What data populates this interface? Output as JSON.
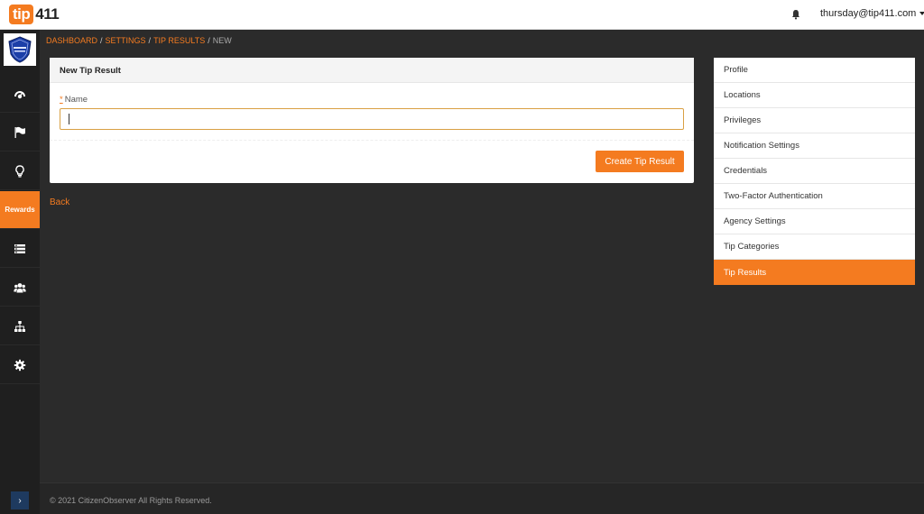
{
  "header": {
    "logo_part1": "tip",
    "logo_part2": "411",
    "user_email": "thursday@tip411.com",
    "notification_icon": "bell-icon"
  },
  "sidebar": {
    "badge_icon": "police-badge-icon",
    "items": [
      {
        "icon": "dashboard-gauge-icon"
      },
      {
        "icon": "flag-icon"
      },
      {
        "icon": "lightbulb-icon"
      },
      {
        "label": "Rewards",
        "active": true
      },
      {
        "icon": "list-icon"
      },
      {
        "icon": "users-icon"
      },
      {
        "icon": "sitemap-icon"
      },
      {
        "icon": "gear-icon"
      }
    ],
    "expand_label": "›"
  },
  "breadcrumb": {
    "dashboard": "Dashboard",
    "settings": "Settings",
    "tip_results": "Tip Results",
    "current": "New"
  },
  "form": {
    "title": "New Tip Result",
    "required_marker": "*",
    "name_label": "Name",
    "name_value": "",
    "submit_label": "Create Tip Result",
    "back_label": "Back"
  },
  "settings_menu": {
    "items": [
      "Profile",
      "Locations",
      "Privileges",
      "Notification Settings",
      "Credentials",
      "Two-Factor Authentication",
      "Agency Settings",
      "Tip Categories",
      "Tip Results"
    ],
    "active_item": "Tip Results"
  },
  "footer": {
    "copyright": "© 2021 CitizenObserver All Rights Reserved."
  },
  "colors": {
    "accent": "#f47b20",
    "sidebar_bg": "#1f1f1f",
    "content_bg": "#2b2b2b"
  }
}
